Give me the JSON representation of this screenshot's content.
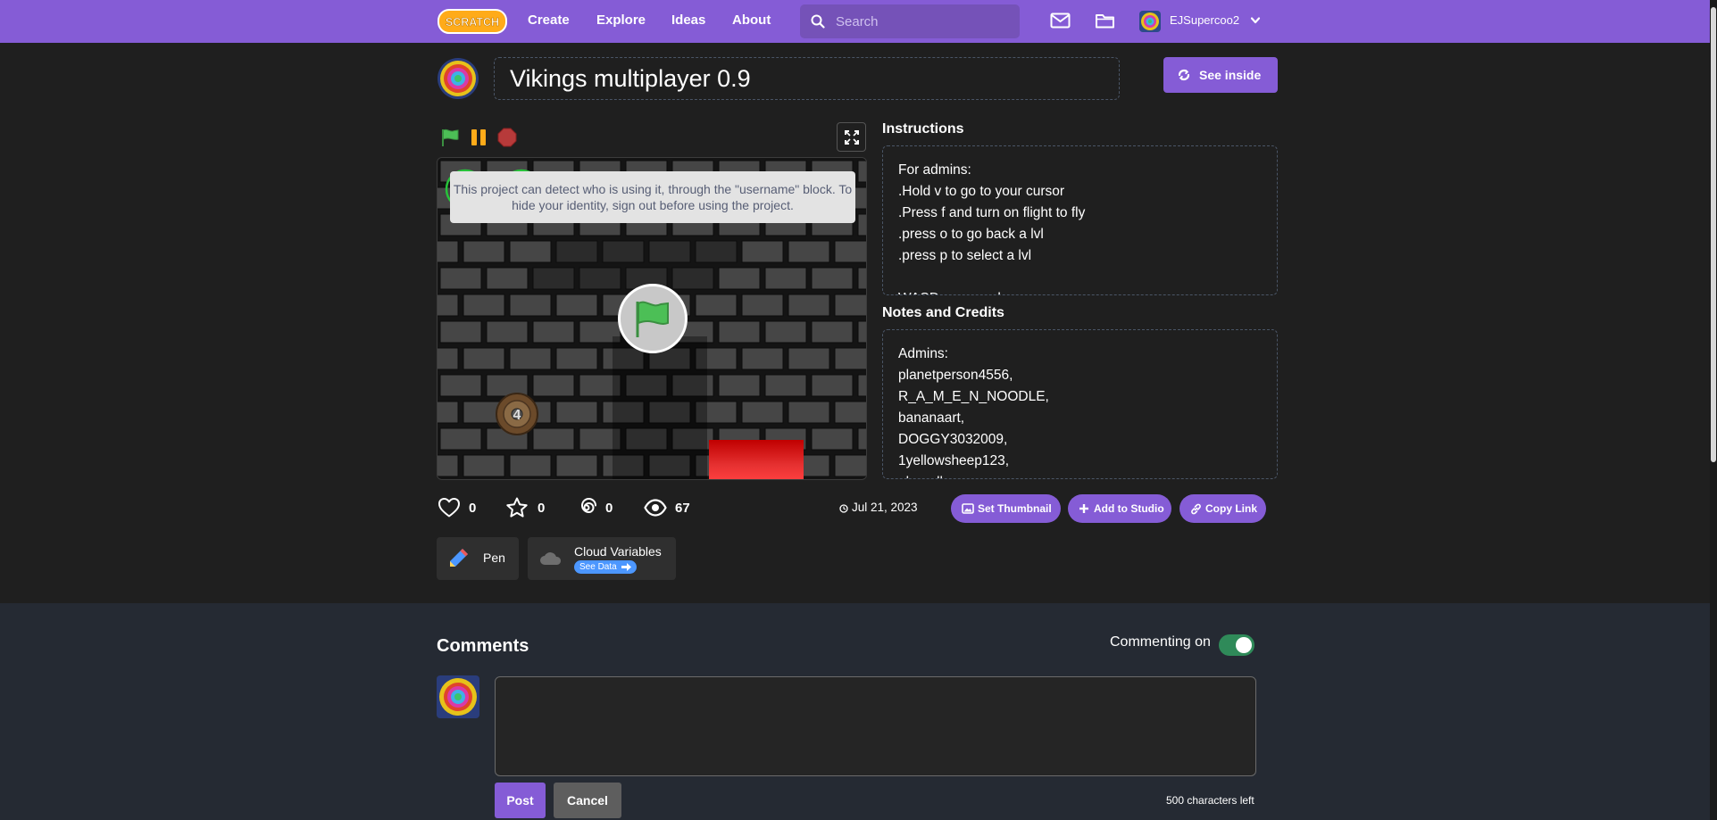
{
  "nav": {
    "logo_text": "SCRATCH",
    "links": [
      "Create",
      "Explore",
      "Ideas",
      "About"
    ],
    "search_placeholder": "Search",
    "username": "EJSupercoo2",
    "icons": [
      "search-icon",
      "messages-icon",
      "my-stuff-icon",
      "chevron-down-icon"
    ]
  },
  "project": {
    "title": "Vikings multiplayer 0.9",
    "see_inside_label": "See inside"
  },
  "player": {
    "notice": "This project can detect who is using it, through the \"username\" block. To hide your identity, sign out before using the project.",
    "stage_label": "4"
  },
  "instructions": {
    "heading": "Instructions",
    "lines": [
      "For admins:",
      ".Hold v to go to your cursor",
      ".Press f and turn on flight to fly",
      ".press o to go back a lvl",
      ".press p to select a lvl",
      "",
      "WASD or arrow keys"
    ]
  },
  "notes": {
    "heading": "Notes and Credits",
    "lines": [
      "Admins:",
      "planetperson4556,",
      "R_A_M_E_N_NOODLE,",
      "bananaart,",
      "DOGGY3032009,",
      "1yellowsheep123,",
      "alanrall"
    ]
  },
  "stats": {
    "loves": "0",
    "favorites": "0",
    "remixes": "0",
    "views": "67"
  },
  "date": "Jul 21, 2023",
  "actions": {
    "set_thumbnail": "Set Thumbnail",
    "add_to_studio": "Add to Studio",
    "copy_link": "Copy Link"
  },
  "extensions": {
    "pen": "Pen",
    "cloud": "Cloud Variables",
    "see_data": "See Data"
  },
  "comments": {
    "heading": "Comments",
    "commenting_label": "Commenting on",
    "commenting_enabled": true,
    "post_label": "Post",
    "cancel_label": "Cancel",
    "chars_left": "500 characters left"
  },
  "colors": {
    "brand": "#855cd6",
    "background": "#1f1f1f",
    "comments_bg": "#252a33",
    "toggle_on": "#2f8a59",
    "flag_green": "#4cbf56",
    "pause_orange": "#ffab19",
    "stop_red": "#ec5959",
    "cloud_tag": "#4c97ff"
  }
}
